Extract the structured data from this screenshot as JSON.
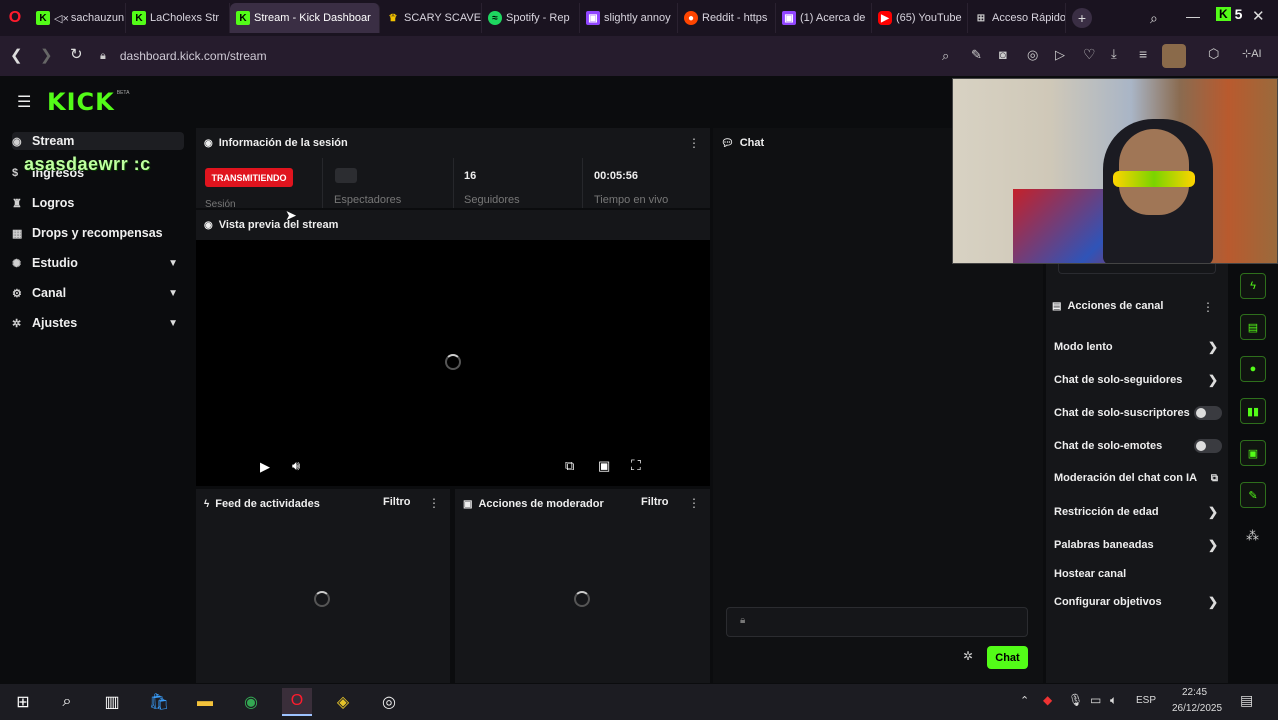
{
  "browser": {
    "tabs": [
      {
        "label": "sachauzun",
        "icon": "kick-favicon",
        "prefix": "◁×"
      },
      {
        "label": "LaCholexs Str",
        "icon": "kick-favicon"
      },
      {
        "label": "Stream - Kick Dashboar",
        "icon": "kick-favicon",
        "active": true
      },
      {
        "label": "SCARY SCAVE",
        "icon": "crown-favicon"
      },
      {
        "label": "Spotify - Rep",
        "icon": "spotify-favicon"
      },
      {
        "label": "slightly annoy",
        "icon": "twitch-favicon"
      },
      {
        "label": "Reddit - https",
        "icon": "reddit-favicon"
      },
      {
        "label": "(1) Acerca de",
        "icon": "twitch-favicon"
      },
      {
        "label": "(65) YouTube",
        "icon": "youtube-favicon"
      },
      {
        "label": "Acceso Rápido",
        "icon": "grid-favicon"
      }
    ],
    "new_tab": "+",
    "url": "dashboard.kick.com/stream",
    "extension_badge": "5",
    "ai_label": "AI"
  },
  "kick": {
    "logo": "KICK",
    "logo_badge": "BETA",
    "overlay_text": "asasdaewrr :c",
    "sidebar": [
      {
        "label": "Stream",
        "icon": "broadcast-icon",
        "active": true
      },
      {
        "label": "Ingresos",
        "icon": "money-icon"
      },
      {
        "label": "Logros",
        "icon": "trophy-icon"
      },
      {
        "label": "Drops y recompensas",
        "icon": "gift-icon"
      },
      {
        "label": "Estudio",
        "icon": "palette-icon",
        "expandable": true
      },
      {
        "label": "Canal",
        "icon": "sliders-icon",
        "expandable": true
      },
      {
        "label": "Ajustes",
        "icon": "gear-icon",
        "expandable": true
      }
    ],
    "session": {
      "title": "Información de la sesión",
      "status_badge": "TRANSMITIENDO",
      "status_label": "Sesión",
      "viewers_label": "Espectadores",
      "followers_value": "16",
      "followers_label": "Seguidores",
      "uptime_value": "00:05:56",
      "uptime_label": "Tiempo en vivo"
    },
    "preview": {
      "title": "Vista previa del stream"
    },
    "feed": {
      "title": "Feed de actividades",
      "filter": "Filtro"
    },
    "mod": {
      "title": "Acciones de moderador",
      "filter": "Filtro"
    },
    "chat": {
      "title": "Chat",
      "send_label": "Chat"
    },
    "channel_actions": {
      "title": "Acciones de canal",
      "items": [
        {
          "label": "Modo lento",
          "control": "arrow"
        },
        {
          "label": "Chat de solo-seguidores",
          "control": "arrow"
        },
        {
          "label": "Chat de solo-suscriptores",
          "control": "toggle"
        },
        {
          "label": "Chat de solo-emotes",
          "control": "toggle"
        },
        {
          "label": "Moderación del chat con IA",
          "control": "external"
        },
        {
          "label": "Restricción de edad",
          "control": "arrow"
        },
        {
          "label": "Palabras baneadas",
          "control": "arrow"
        },
        {
          "label": "Hostear canal",
          "control": "none"
        },
        {
          "label": "Configurar objetivos",
          "control": "arrow"
        }
      ]
    },
    "accent": "#53fc18"
  },
  "taskbar": {
    "language": "ESP",
    "time": "22:45",
    "date": "26/12/2025"
  }
}
